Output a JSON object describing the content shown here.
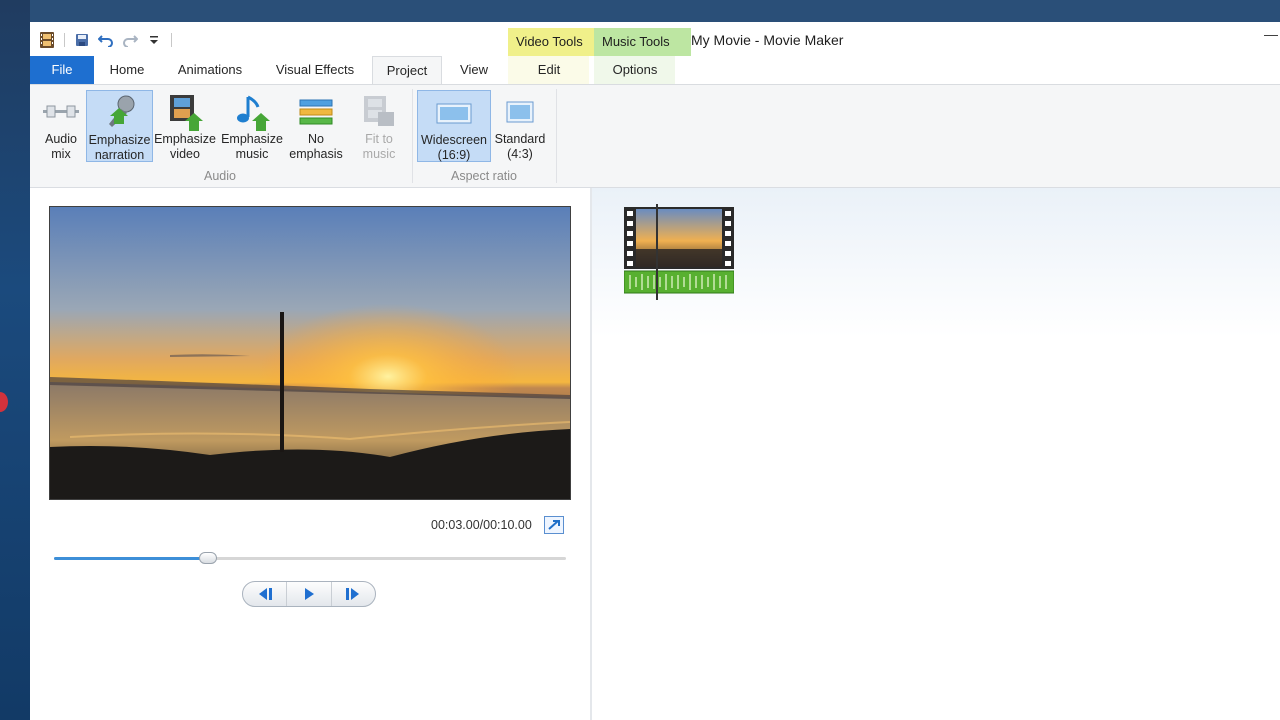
{
  "window": {
    "title": "My Movie - Movie Maker",
    "minimize_glyph": "—"
  },
  "quick_access": {
    "icons": [
      "movie-maker-app-icon",
      "save-icon",
      "undo-icon",
      "redo-icon",
      "customize-dropdown-icon"
    ]
  },
  "contextual_tabs": {
    "video_tools": "Video Tools",
    "music_tools": "Music Tools",
    "video_tools_color": "#f0f08a",
    "music_tools_color": "#bde6a2"
  },
  "tabs": {
    "file": "File",
    "home": "Home",
    "animations": "Animations",
    "visual_effects": "Visual Effects",
    "project": "Project",
    "view": "View",
    "edit": "Edit",
    "options": "Options",
    "active": "Project"
  },
  "ribbon": {
    "audio_group": {
      "label": "Audio",
      "buttons": [
        {
          "line1": "Audio",
          "line2": "mix",
          "icon": "audio-mix-slider-icon",
          "selected": false,
          "disabled": false
        },
        {
          "line1": "Emphasize",
          "line2": "narration",
          "icon": "microphone-icon",
          "selected": true,
          "disabled": false
        },
        {
          "line1": "Emphasize",
          "line2": "video",
          "icon": "film-emphasis-icon",
          "selected": false,
          "disabled": false
        },
        {
          "line1": "Emphasize",
          "line2": "music",
          "icon": "music-note-icon",
          "selected": false,
          "disabled": false
        },
        {
          "line1": "No",
          "line2": "emphasis",
          "icon": "equal-bars-icon",
          "selected": false,
          "disabled": false
        },
        {
          "line1": "Fit to",
          "line2": "music",
          "icon": "fit-to-music-icon",
          "selected": false,
          "disabled": true
        }
      ]
    },
    "aspect_group": {
      "label": "Aspect ratio",
      "buttons": [
        {
          "line1": "Widescreen",
          "line2": "(16:9)",
          "icon": "widescreen-icon",
          "selected": true
        },
        {
          "line1": "Standard",
          "line2": "(4:3)",
          "icon": "standard-icon",
          "selected": false
        }
      ]
    }
  },
  "preview": {
    "time": "00:03.00/00:10.00",
    "progress_fraction": 0.3
  },
  "colors": {
    "file_tab": "#1e6fd0",
    "accent": "#3d8fd8",
    "selected_button": "#c5dcf6"
  }
}
